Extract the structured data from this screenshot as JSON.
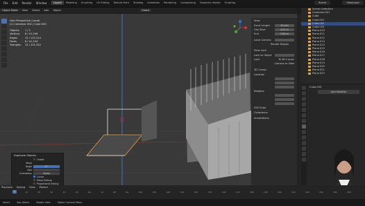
{
  "topbar": {
    "menu": [
      "File",
      "Edit",
      "Render",
      "Window",
      "Help"
    ],
    "workspaces": [
      "Layout",
      "Modeling",
      "Sculpting",
      "UV Editing",
      "Texture Paint",
      "Shading",
      "Animation",
      "Rendering",
      "Compositing",
      "Geometry Nodes",
      "Scripting"
    ],
    "active_workspace": "Layout",
    "scene": "Scene",
    "view_layer": "ViewLayer"
  },
  "header2": {
    "mode": "Object Mode",
    "items": [
      "View",
      "Select",
      "Add",
      "Object"
    ],
    "transform": "Global"
  },
  "overlay": {
    "line1": "User Perspective (Local)",
    "line2": "(1) Container 002 | Cube.003",
    "stats": [
      [
        "Objects",
        "1 / 1"
      ],
      [
        "Vertices",
        "8 / 41,246"
      ],
      [
        "Edges",
        "12 / 107,214"
      ],
      [
        "Faces",
        "6 / 41,104"
      ],
      [
        "Triangles",
        "12 / 101,322"
      ]
    ]
  },
  "npanel": {
    "view": "View",
    "focal_label": "Focal Length",
    "focal_value": "50 mm",
    "clip_start_label": "Clip Start",
    "clip_start_value": "0.01 m",
    "end_label": "End",
    "end_value": "1000 m",
    "local_camera": "Local Camera",
    "render_region": "Render Region",
    "view_lock": "View Lock",
    "lock_to_object": "Lock to Object",
    "lock": "Lock",
    "to_3d_cursor": "To 3D Cursor",
    "camera_to_view": "Camera to View",
    "cursor3d": "3D Cursor",
    "location": "Location",
    "rotation": "Rotation",
    "xyz_euler": "XYZ Euler",
    "collections": "Collections",
    "annotations": "Annotations"
  },
  "outliner": {
    "items": [
      {
        "name": "Scene Collection",
        "sel": false
      },
      {
        "name": "Container.001",
        "sel": false
      },
      {
        "name": "Cube",
        "sel": false
      },
      {
        "name": "Cube.001",
        "sel": false
      },
      {
        "name": "Cube.002",
        "sel": true
      },
      {
        "name": "Cube.003",
        "sel": false
      },
      {
        "name": "Plane.010",
        "sel": false
      },
      {
        "name": "Plane.011",
        "sel": false
      },
      {
        "name": "Plane.012",
        "sel": false
      },
      {
        "name": "Plane.013",
        "sel": false
      },
      {
        "name": "Plane.014",
        "sel": false
      },
      {
        "name": "Plane.015",
        "sel": false
      },
      {
        "name": "Plane.016",
        "sel": false
      },
      {
        "name": "Plane.017",
        "sel": false
      },
      {
        "name": "Plane.018",
        "sel": false
      },
      {
        "name": "Plane.019",
        "sel": false
      },
      {
        "name": "Plane.020",
        "sel": false
      },
      {
        "name": "Plane.021",
        "sel": false
      },
      {
        "name": "Plane.022",
        "sel": false
      }
    ]
  },
  "properties": {
    "object": "Cube.003",
    "add_modifier": "Add Modifier"
  },
  "op_dialog": {
    "title": "Duplicate Objects",
    "linked": "Linked",
    "move": "Move",
    "angle_label": "Angle",
    "angle_value": "0°",
    "axis_label": "Axis",
    "orientation_label": "Orientation",
    "orientation_value": "Global",
    "pivot": "Cursor",
    "mirror_editing": "Mirror Editing",
    "proportional_editing": "Proportional Editing"
  },
  "timeline": {
    "items": [
      "Playback",
      "Keying",
      "View",
      "Marker"
    ],
    "ticks": [
      "0",
      "10",
      "20",
      "30",
      "40",
      "50",
      "60",
      "70",
      "80",
      "90",
      "100",
      "110",
      "120",
      "130",
      "140",
      "150",
      "160",
      "170",
      "180",
      "190",
      "200",
      "210",
      "220",
      "230",
      "240",
      "250"
    ],
    "current_frame": "1"
  },
  "status": {
    "items": [
      "Select",
      "Box Select",
      "Rotate View",
      "Object Context Menu"
    ]
  },
  "colors": {
    "accent": "#4772b3",
    "selection_orange": "#e6a13a",
    "viewport_bg": "#393939"
  }
}
